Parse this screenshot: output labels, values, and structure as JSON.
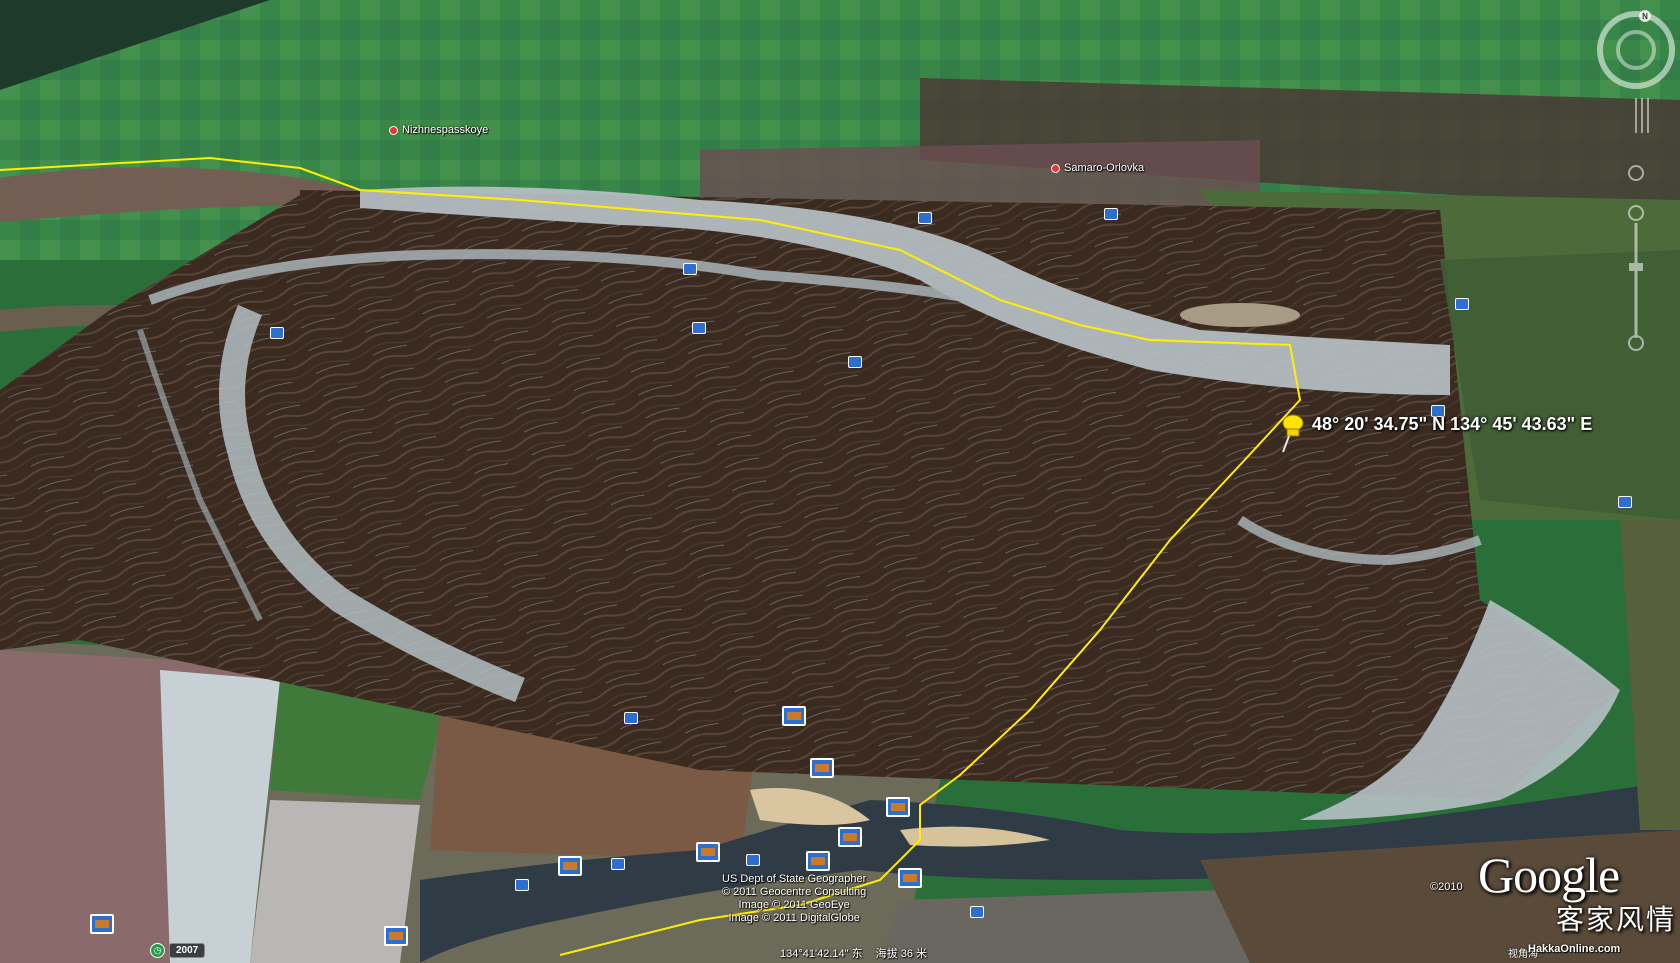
{
  "map": {
    "places": [
      {
        "name": "Nizhnespasskoye"
      },
      {
        "name": "Samaro-Orlovka"
      }
    ],
    "placemark": {
      "coordinates": "48° 20' 34.75\" N  134° 45' 43.63\" E"
    },
    "credits": [
      "US Dept of State Geographer",
      "© 2011 Geocentre Consulting",
      "Image © 2011 GeoEye",
      "Image © 2011 DigitalGlobe"
    ],
    "status": {
      "longitude": "134°41'42.14\" 东",
      "elevation": "海拔    36 米"
    },
    "imagery_year": "2007",
    "copyright_year": "©2010",
    "brand": "Google",
    "watermark_cn": "客家风情",
    "watermark_url": "HakkaOnline.com",
    "view_alt_label": "视角海",
    "icons": [
      "north-compass-icon",
      "look-joystick-icon",
      "zoom-slider-icon",
      "placemark-pushpin-icon",
      "photo-thumbnail-icon",
      "history-clock-icon"
    ],
    "colors": {
      "floodplain": "#3b2a20",
      "river_ice": "#b8c2c6",
      "forest": "#2f7a3e",
      "path_line": "#ffee00",
      "pin": "#ffe400"
    }
  }
}
